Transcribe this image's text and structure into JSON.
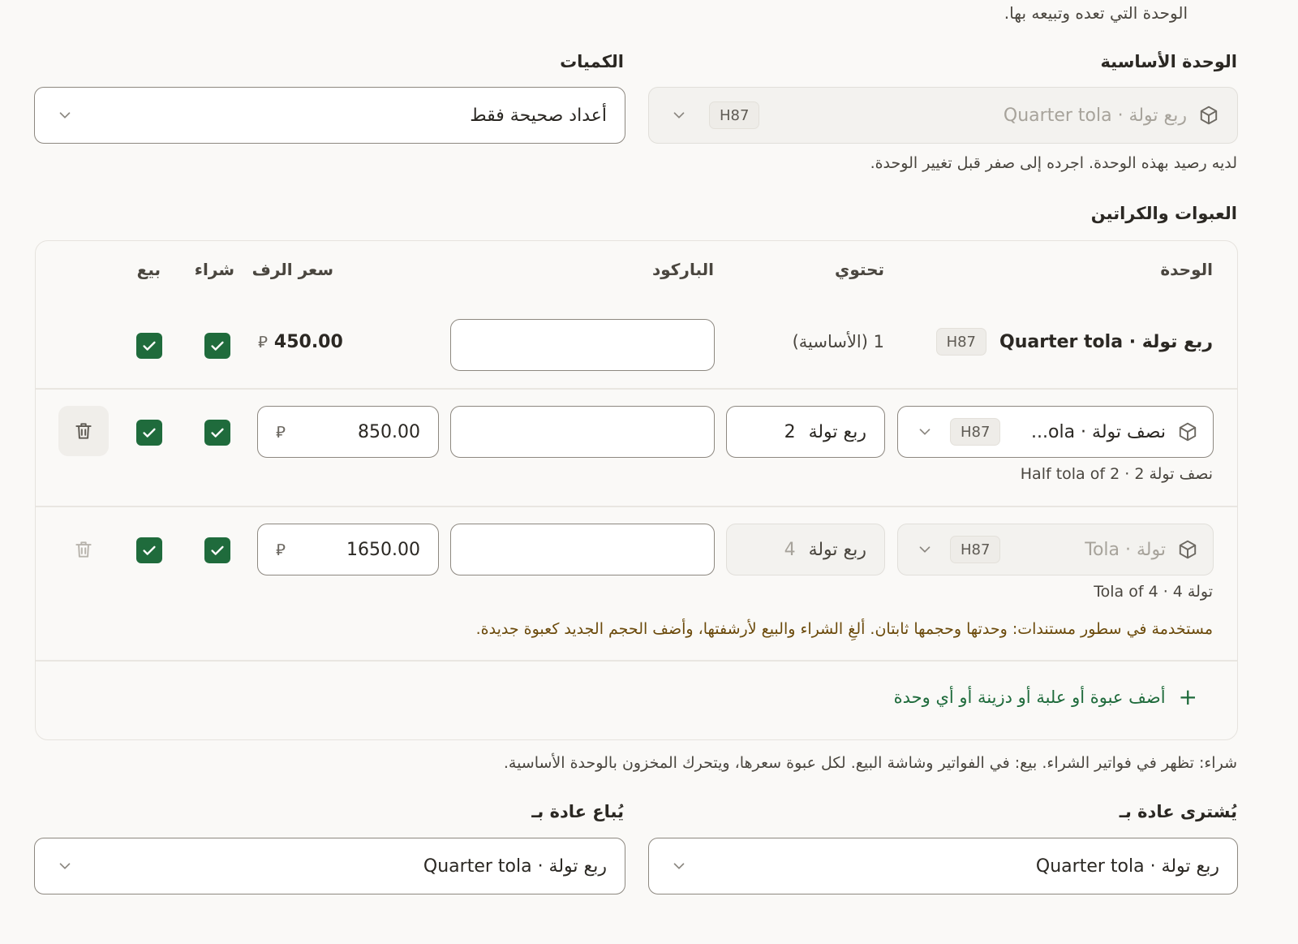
{
  "top_note": "الوحدة التي تعده وتبيعه بها.",
  "base_unit": {
    "label": "الوحدة الأساسية",
    "value": "ربع تولة · Quarter tola",
    "code": "H87",
    "hint": "لديه رصيد بهذه الوحدة. اجرده إلى صفر قبل تغيير الوحدة."
  },
  "quantities": {
    "label": "الكميات",
    "value": "أعداد صحيحة فقط"
  },
  "packs": {
    "title": "العبوات والكراتين",
    "headers": {
      "unit": "الوحدة",
      "contains": "تحتوي",
      "barcode": "الباركود",
      "shelf_price": "سعر الرف",
      "buy": "شراء",
      "sell": "بيع"
    },
    "rows": [
      {
        "unit": "ربع تولة · Quarter tola",
        "code": "H87",
        "contains": "1 (الأساسية)",
        "barcode": "",
        "price": "450.00",
        "currency": "⃁",
        "buy": true,
        "sell": true
      },
      {
        "unit": "نصف تولة · ola...",
        "code": "H87",
        "contains_qty": "2",
        "contains_unit": "ربع تولة",
        "barcode": "",
        "price": "850.00",
        "currency": "⃁",
        "buy": true,
        "sell": true,
        "subtitle": "نصف تولة 2 · Half tola of 2"
      },
      {
        "unit": "تولة · Tola",
        "code": "H87",
        "contains_qty": "4",
        "contains_unit": "ربع تولة",
        "barcode": "",
        "price": "1650.00",
        "currency": "⃁",
        "buy": true,
        "sell": true,
        "subtitle": "تولة 4 · Tola of 4",
        "warning": "مستخدمة في سطور مستندات: وحدتها وحجمها ثابتان. ألغِ الشراء والبيع لأرشفتها، وأضف الحجم الجديد كعبوة جديدة."
      }
    ],
    "add_label": "أضف عبوة أو علبة أو دزينة أو أي وحدة",
    "add_icon": "+"
  },
  "footer_note": "شراء: تظهر في فواتير الشراء. بيع: في الفواتير وشاشة البيع. لكل عبوة سعرها، ويتحرك المخزون بالوحدة الأساسية.",
  "purchase_default": {
    "label": "يُشترى عادة بـ",
    "value": "ربع تولة · Quarter tola"
  },
  "sale_default": {
    "label": "يُباع عادة بـ",
    "value": "ربع تولة · Quarter tola"
  },
  "colors": {
    "accent_green": "#1f6b3c",
    "warning_text": "#6b4a0b",
    "background": "#faf9f7"
  }
}
